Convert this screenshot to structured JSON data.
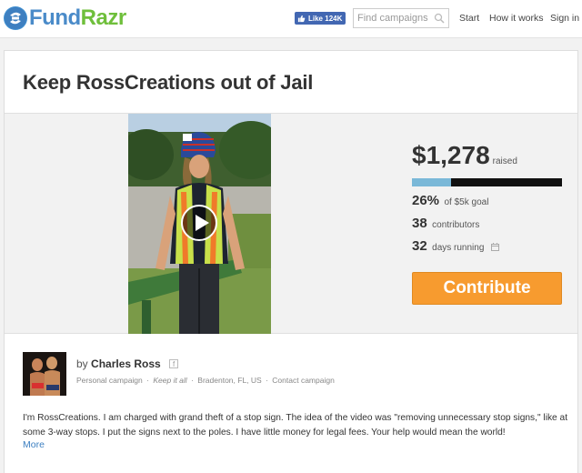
{
  "header": {
    "logo": {
      "fund": "Fund",
      "razr": "Razr"
    },
    "fb_like": {
      "label": "Like",
      "count": "124K"
    },
    "search": {
      "placeholder": "Find campaigns"
    },
    "nav": {
      "start": "Start",
      "how": "How it works",
      "signin": "Sign in"
    }
  },
  "campaign": {
    "title": "Keep RossCreations out of Jail",
    "amount_raised": "$1,278",
    "raised_label": "raised",
    "progress_fraction": 0.26,
    "percent": "26%",
    "percent_label": "of $5k goal",
    "contributors": "38",
    "contributors_label": "contributors",
    "days": "32",
    "days_label": "days running",
    "contribute_label": "Contribute"
  },
  "owner": {
    "by": "by",
    "name": "Charles Ross",
    "fb_badge": "f",
    "type": "Personal campaign",
    "tag": "Keep it all",
    "location": "Bradenton, FL, US",
    "contact": "Contact campaign",
    "separator": "·"
  },
  "description": {
    "text": "I'm RossCreations. I am charged with grand theft of a stop sign. The idea of the video was \"removing unnecessary stop signs,\" like at some 3-way stops. I put the signs next to the poles. I have little money for legal fees. Your help would mean the world!",
    "more": "More"
  },
  "colors": {
    "brand_blue": "#4a8bc9",
    "brand_green": "#6fbf3b",
    "contribute": "#f79b2f",
    "progress": "#7ab8d8",
    "link": "#3c7fc1"
  }
}
